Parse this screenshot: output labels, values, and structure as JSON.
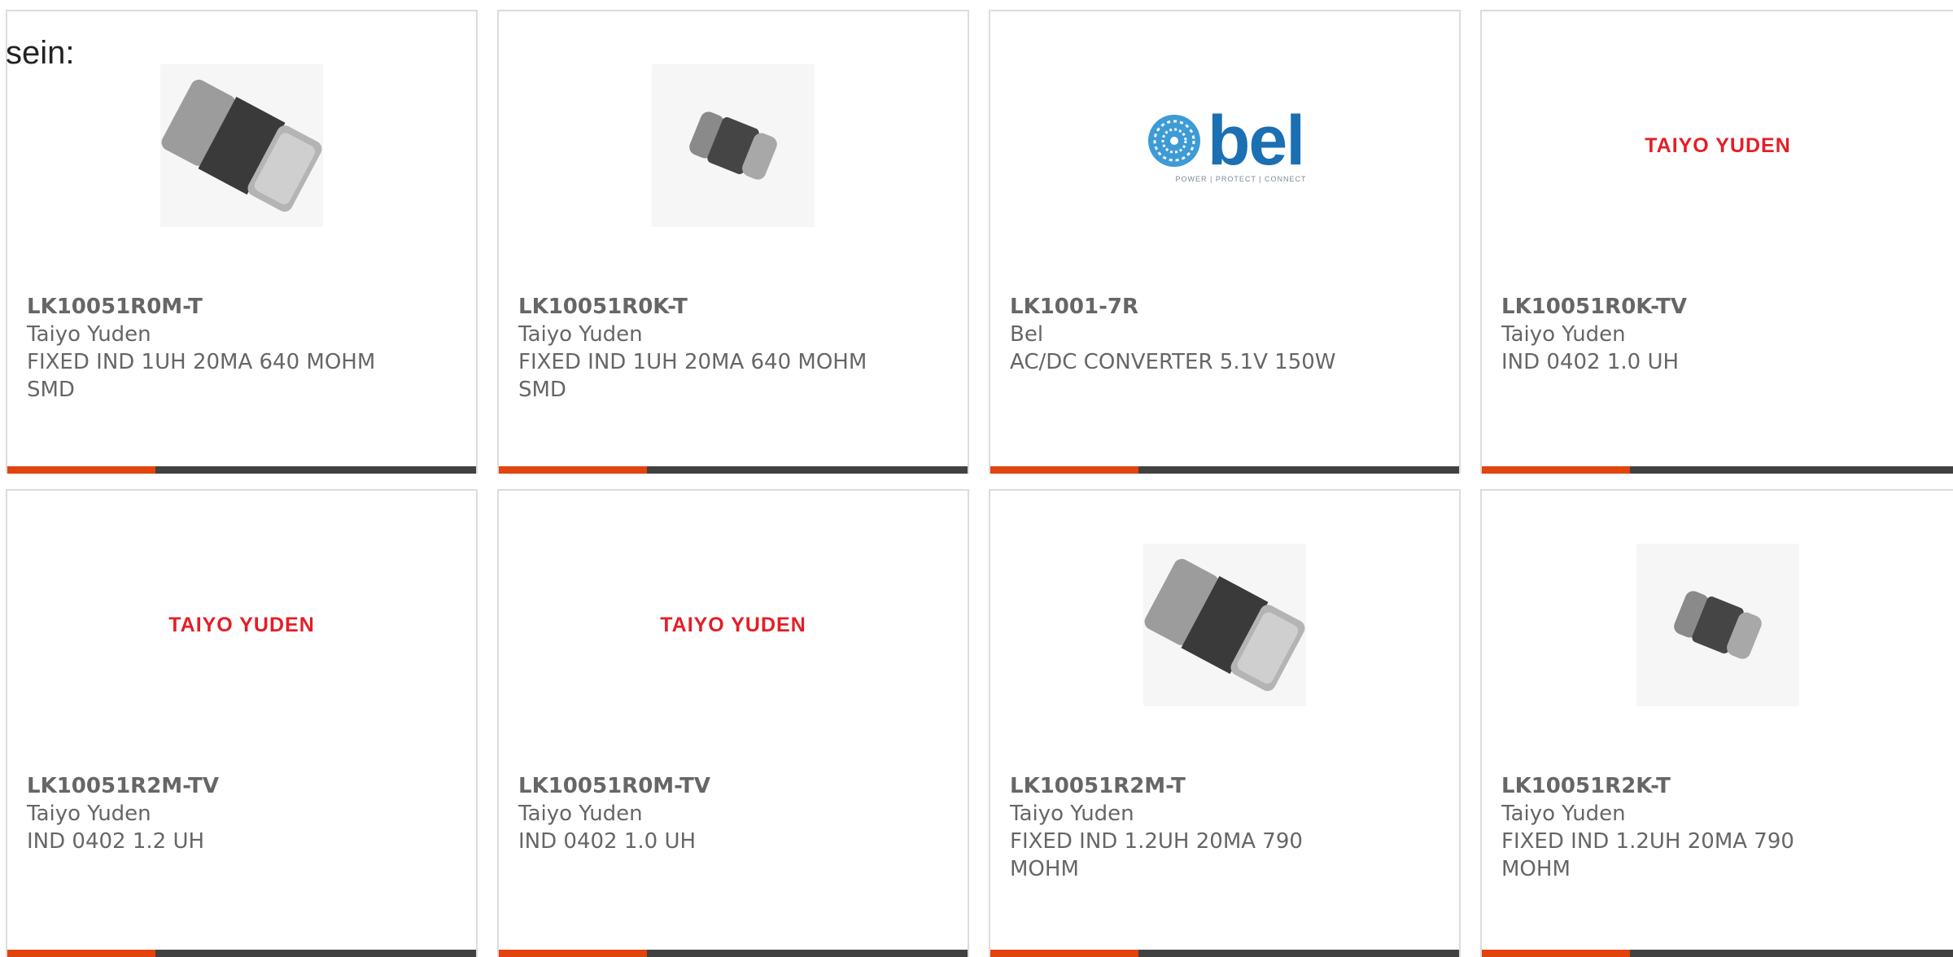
{
  "intro_text": "sein:",
  "colors": {
    "accent": "#e2430f",
    "bar": "#414141",
    "taiyo_red": "#e41e26",
    "bel_blue": "#1b6fb3"
  },
  "products": [
    {
      "part_number": "LK10051R0M-T",
      "manufacturer": "Taiyo Yuden",
      "description": "FIXED IND 1UH 20MA 640 MOHM SMD",
      "image": "chip-inductor-large"
    },
    {
      "part_number": "LK10051R0K-T",
      "manufacturer": "Taiyo Yuden",
      "description": "FIXED IND 1UH 20MA 640 MOHM SMD",
      "image": "chip-inductor-small"
    },
    {
      "part_number": "LK1001-7R",
      "manufacturer": "Bel",
      "description": "AC/DC CONVERTER 5.1V 150W",
      "image": "bel-logo",
      "logo_text": "bel",
      "logo_tagline": "POWER | PROTECT | CONNECT"
    },
    {
      "part_number": "LK10051R0K-TV",
      "manufacturer": "Taiyo Yuden",
      "description": "IND 0402 1.0 UH",
      "image": "taiyo-yuden-logo",
      "logo_text": "TAIYO YUDEN"
    },
    {
      "part_number": "LK10051R2M-TV",
      "manufacturer": "Taiyo Yuden",
      "description": "IND 0402 1.2 UH",
      "image": "taiyo-yuden-logo",
      "logo_text": "TAIYO YUDEN"
    },
    {
      "part_number": "LK10051R0M-TV",
      "manufacturer": "Taiyo Yuden",
      "description": "IND 0402 1.0 UH",
      "image": "taiyo-yuden-logo",
      "logo_text": "TAIYO YUDEN"
    },
    {
      "part_number": "LK10051R2M-T",
      "manufacturer": "Taiyo Yuden",
      "description": "FIXED IND 1.2UH 20MA 790 MOHM",
      "image": "chip-inductor-large"
    },
    {
      "part_number": "LK10051R2K-T",
      "manufacturer": "Taiyo Yuden",
      "description": "FIXED IND 1.2UH 20MA 790 MOHM",
      "image": "chip-inductor-small"
    }
  ]
}
